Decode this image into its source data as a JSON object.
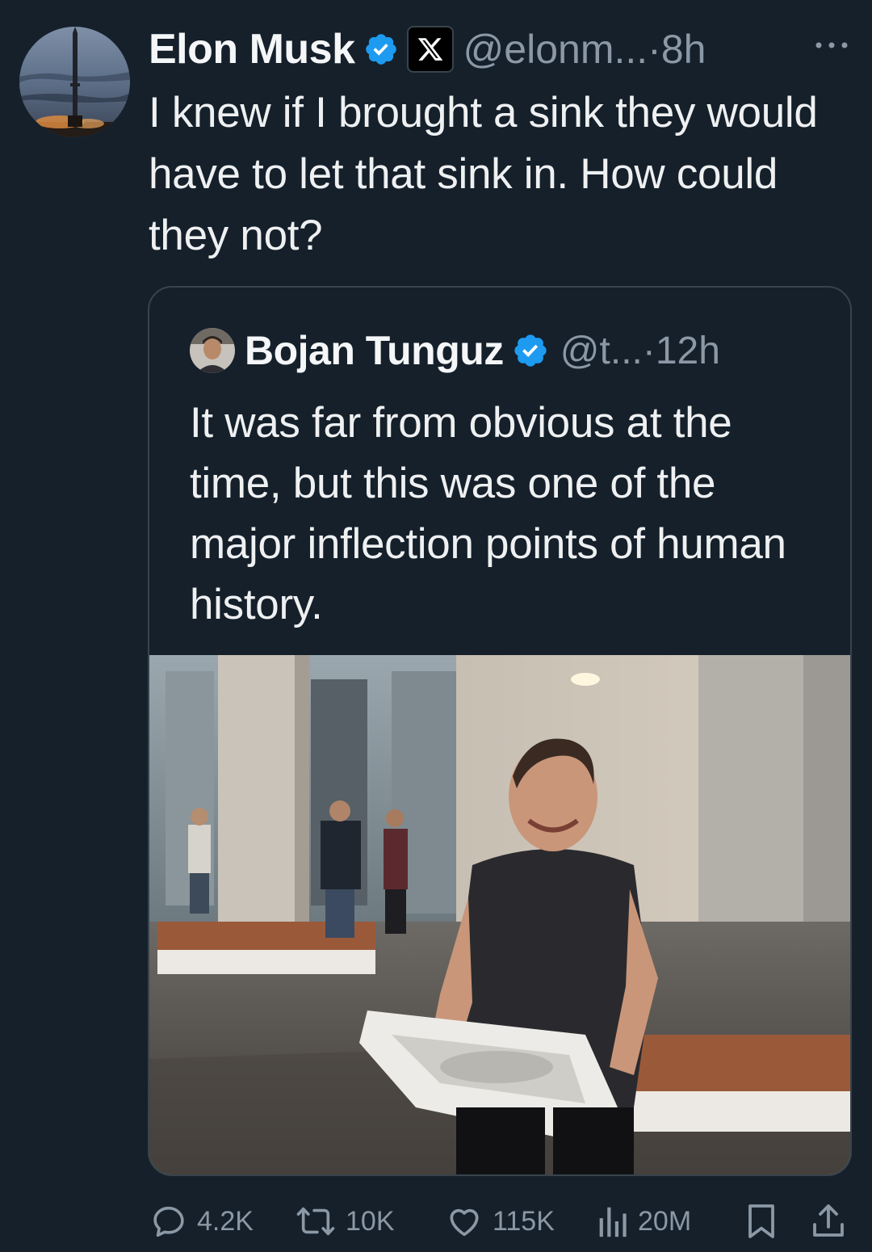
{
  "author": {
    "name": "Elon Musk",
    "handle": "@elonm...",
    "separator": "·",
    "time": "8h",
    "avatar_icon": "rocket-launch-avatar"
  },
  "tweet": {
    "text": "I knew if I brought a sink they would have to let that sink in. How could they not?"
  },
  "quoted": {
    "name": "Bojan Tunguz",
    "handle": "@t...",
    "separator": "·",
    "time": "12h",
    "text": "It was far from obvious at the time, but this was one of the major inflection points of human history.",
    "media_icon": "man-carrying-sink-photo"
  },
  "metrics": {
    "replies": "4.2K",
    "reposts": "10K",
    "likes": "115K",
    "views": "20M"
  },
  "colors": {
    "background": "#15202b",
    "verified": "#1d9bf0",
    "muted_text": "#8b98a5",
    "border": "#38444d"
  }
}
